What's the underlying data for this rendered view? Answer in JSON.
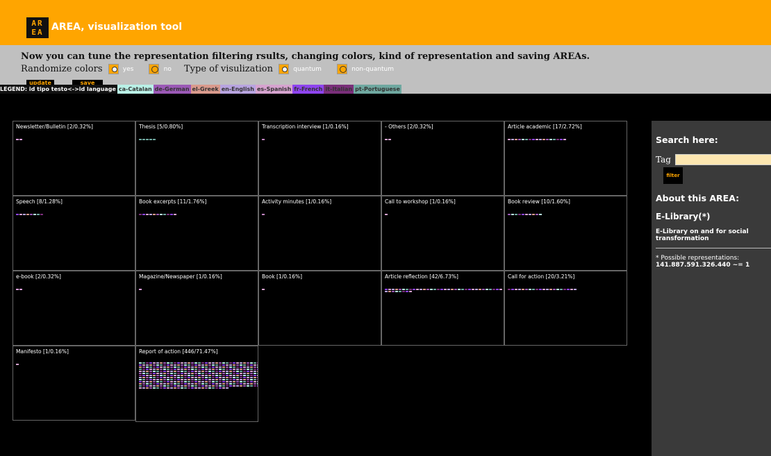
{
  "app": {
    "logo_text": "AR EA",
    "title": "AREA, visualization tool"
  },
  "controls": {
    "message": "Now you can tune the representation filtering rsults, changing colors, kind of representation and saving AREAs.",
    "randomize_label": "Randomize colors",
    "yes_label": "yes",
    "no_label": "no",
    "type_label": "Type of visulization",
    "quantum_label": "quantum",
    "nonquantum_label": "non-quantum",
    "update_label": "update",
    "save_label": "save this",
    "randomize_selected": "yes",
    "type_selected": "quantum"
  },
  "legend": {
    "lead": "LEGEND: id tipo testo<->id language",
    "items": [
      {
        "label": "ca-Catalan",
        "color": "#b9f0e6"
      },
      {
        "label": "de-German",
        "color": "#9b59b6"
      },
      {
        "label": "el-Greek",
        "color": "#d99a8c"
      },
      {
        "label": "en-English",
        "color": "#b8a4e0"
      },
      {
        "label": "es-Spanish",
        "color": "#d6a3cf"
      },
      {
        "label": "fr-French",
        "color": "#8e44ef"
      },
      {
        "label": "it-Italian",
        "color": "#7a2f7a"
      },
      {
        "label": "pt-Portuguese",
        "color": "#6fa8a0"
      }
    ]
  },
  "cells": [
    {
      "title": "Newsletter/Bulletin [2/0.32%]",
      "count": 2,
      "color": "#e0a0e0"
    },
    {
      "title": "Thesis [5/0.80%]",
      "count": 5,
      "color": "#6fa8a0"
    },
    {
      "title": "Transcription interview [1/0.16%]",
      "count": 1,
      "color": "#c084c0"
    },
    {
      "title": "- Others [2/0.32%]",
      "count": 2,
      "color": "#d6a3cf"
    },
    {
      "title": "Article academic [17/2.72%]",
      "count": 17,
      "color": "#9b59b6"
    },
    {
      "title": "Speech [8/1.28%]",
      "count": 8,
      "color": "#c084c0"
    },
    {
      "title": "Book excerpts [11/1.76%]",
      "count": 11,
      "color": "#d6a3cf"
    },
    {
      "title": "Activity minutes [1/0.16%]",
      "count": 1,
      "color": "#c084c0"
    },
    {
      "title": "Call to workshop [1/0.16%]",
      "count": 1,
      "color": "#d6a3cf"
    },
    {
      "title": "Book review [10/1.60%]",
      "count": 10,
      "color": "#c084c0"
    },
    {
      "title": "e-book [2/0.32%]",
      "count": 2,
      "color": "#e0a0e0"
    },
    {
      "title": "Magazine/Newspaper [1/0.16%]",
      "count": 1,
      "color": "#e0a0e0"
    },
    {
      "title": "Book [1/0.16%]",
      "count": 1,
      "color": "#d6a3cf"
    },
    {
      "title": "Article reflection [42/6.73%]",
      "count": 42,
      "color": "#6fa8a0"
    },
    {
      "title": "Call for action [20/3.21%]",
      "count": 20,
      "color": "#9b59b6"
    },
    {
      "title": "Manifesto [1/0.16%]",
      "count": 1,
      "color": "#d6a3cf"
    },
    {
      "title": "Report of action [446/71.47%]",
      "count": 446,
      "color": "#d6a3cf"
    }
  ],
  "sidebar": {
    "search_heading": "Search here:",
    "tag_label": "Tag",
    "tag_value": "",
    "filter_label": "filter",
    "about_heading": "About this AREA:",
    "area_name": "E-Library(*)",
    "area_desc": "E-Library on and for social transformation",
    "note_line1": "* Possible representations:",
    "note_line2": "141.887.591.326.440 ~= 1"
  }
}
